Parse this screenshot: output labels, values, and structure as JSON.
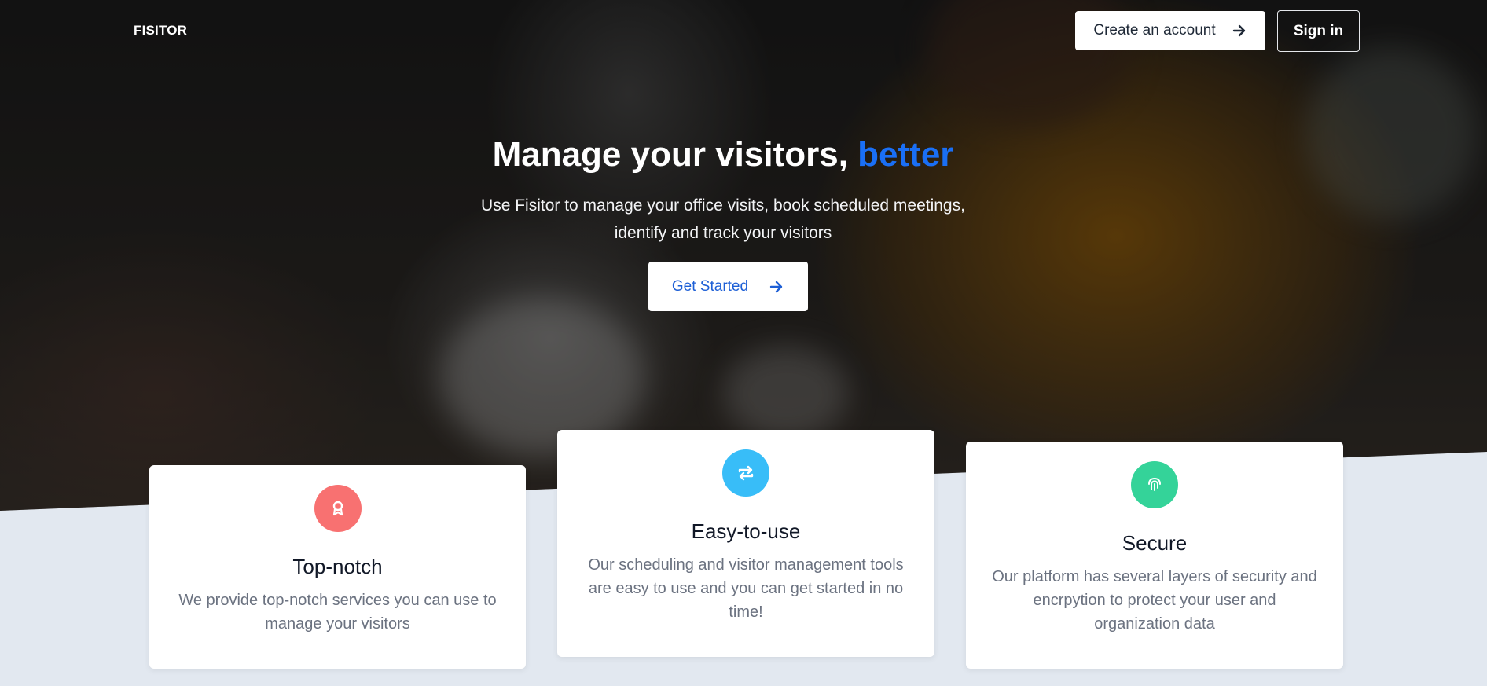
{
  "header": {
    "logo": "FISITOR",
    "create_account": "Create an account",
    "sign_in": "Sign in"
  },
  "hero": {
    "headline_main": "Manage your visitors,",
    "headline_accent": "better",
    "subtext": "Use Fisitor to manage your office visits, book scheduled meetings, identify and track your visitors",
    "cta": "Get Started"
  },
  "colors": {
    "accent": "#1a6ff5",
    "badge_red": "#f87171",
    "badge_blue": "#38bdf8",
    "badge_green": "#34d399"
  },
  "features": [
    {
      "icon": "award-icon",
      "title": "Top-notch",
      "description": "We provide top-notch services you can use to manage your visitors"
    },
    {
      "icon": "repeat-icon",
      "title": "Easy-to-use",
      "description": "Our scheduling and visitor management tools are easy to use and you can get started in no time!"
    },
    {
      "icon": "fingerprint-icon",
      "title": "Secure",
      "description": "Our platform has several layers of security and encrpytion to protect your user and organization data"
    }
  ]
}
